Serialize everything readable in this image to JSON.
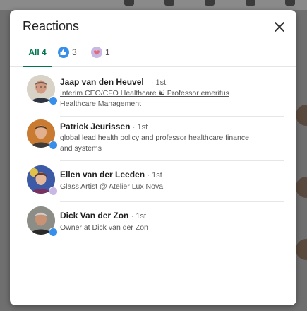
{
  "modal": {
    "title": "Reactions",
    "close_icon": "close-icon"
  },
  "tabs": [
    {
      "label": "All 4",
      "selected": true
    },
    {
      "icon": "like-icon",
      "count": "3"
    },
    {
      "icon": "support-icon",
      "count": "1"
    }
  ],
  "reactors": [
    {
      "name": "Jaap van den Heuvel_",
      "degree": "· 1st",
      "headline": "Interim CEO/CFO Healthcare ☯ Professor emeritus Healthcare Management",
      "reaction": "like-icon"
    },
    {
      "name": "Patrick Jeurissen",
      "degree": "· 1st",
      "headline": "global lead health policy and professor healthcare finance and systems",
      "reaction": "like-icon"
    },
    {
      "name": "Ellen van der Leeden",
      "degree": "· 1st",
      "headline": "Glass Artist @ Atelier Lux Nova",
      "reaction": "support-icon"
    },
    {
      "name": "Dick Van der Zon",
      "degree": "· 1st",
      "headline": "Owner at Dick van der Zon",
      "reaction": "like-icon"
    }
  ],
  "colors": {
    "accent": "#01754f",
    "like": "#378fe9",
    "support": "#c9b8e4"
  }
}
